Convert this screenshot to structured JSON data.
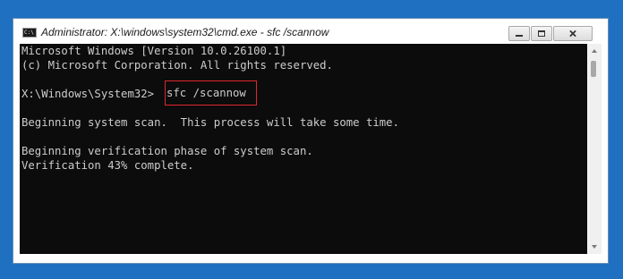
{
  "window": {
    "title": "Administrator: X:\\windows\\system32\\cmd.exe - sfc  /scannow",
    "icon_label": "C:\\",
    "icon": "cmd-icon"
  },
  "controls": {
    "minimize": "minimize-icon",
    "maximize": "maximize-icon",
    "close": "close-icon"
  },
  "console": {
    "lines": [
      "Microsoft Windows [Version 10.0.26100.1]",
      "(c) Microsoft Corporation. All rights reserved.",
      "X:\\Windows\\System32>",
      "Beginning system scan.  This process will take some time.",
      "Beginning verification phase of system scan.",
      "Verification 43% complete."
    ],
    "command": "sfc /scannow",
    "highlight_color": "#e0272d",
    "text_color": "#cccccc",
    "background_color": "#0c0c0c"
  }
}
